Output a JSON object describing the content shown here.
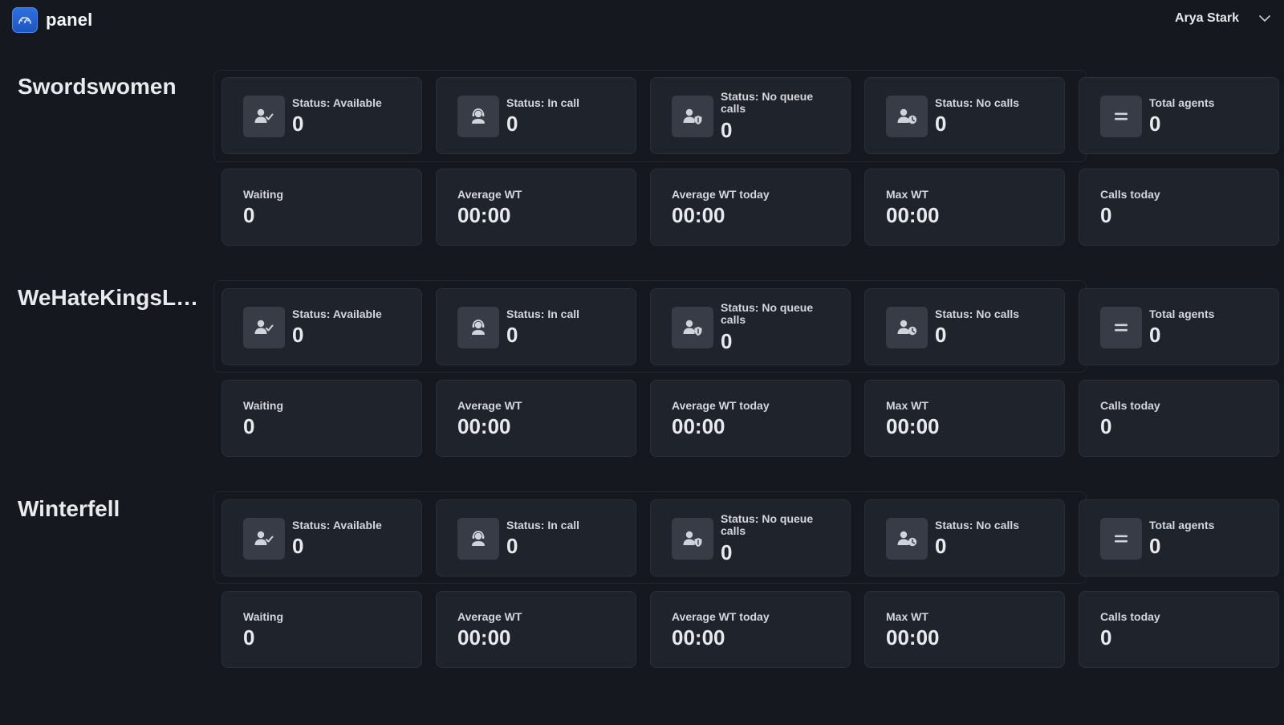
{
  "app": {
    "title": "panel"
  },
  "user": {
    "name": "Arya Stark"
  },
  "icons": {
    "logo": "dashboard-gauge-icon",
    "available": "user-check-icon",
    "in_call": "headset-agent-icon",
    "no_queue_calls": "user-shield-icon",
    "no_calls": "user-clock-icon",
    "total": "equals-icon",
    "chevron": "chevron-down-icon"
  },
  "colors": {
    "background": "#15181e",
    "card": "#1f232b",
    "icon_box": "#373c46",
    "accent": "#2f6fe0"
  },
  "queues": [
    {
      "name": "Swordswomen",
      "status": {
        "available_label": "Status: Available",
        "available_value": "0",
        "in_call_label": "Status: In call",
        "in_call_value": "0",
        "no_queue_label": "Status: No queue calls",
        "no_queue_value": "0",
        "no_calls_label": "Status: No calls",
        "no_calls_value": "0",
        "total_label": "Total agents",
        "total_value": "0"
      },
      "stats": {
        "waiting_label": "Waiting",
        "waiting_value": "0",
        "avg_wt_label": "Average WT",
        "avg_wt_value": "00:00",
        "avg_wt_today_label": "Average WT today",
        "avg_wt_today_value": "00:00",
        "max_wt_label": "Max WT",
        "max_wt_value": "00:00",
        "calls_today_label": "Calls today",
        "calls_today_value": "0"
      }
    },
    {
      "name": "WeHateKingsL…",
      "status": {
        "available_label": "Status: Available",
        "available_value": "0",
        "in_call_label": "Status: In call",
        "in_call_value": "0",
        "no_queue_label": "Status: No queue calls",
        "no_queue_value": "0",
        "no_calls_label": "Status: No calls",
        "no_calls_value": "0",
        "total_label": "Total agents",
        "total_value": "0"
      },
      "stats": {
        "waiting_label": "Waiting",
        "waiting_value": "0",
        "avg_wt_label": "Average WT",
        "avg_wt_value": "00:00",
        "avg_wt_today_label": "Average WT today",
        "avg_wt_today_value": "00:00",
        "max_wt_label": "Max WT",
        "max_wt_value": "00:00",
        "calls_today_label": "Calls today",
        "calls_today_value": "0"
      }
    },
    {
      "name": "Winterfell",
      "status": {
        "available_label": "Status: Available",
        "available_value": "0",
        "in_call_label": "Status: In call",
        "in_call_value": "0",
        "no_queue_label": "Status: No queue calls",
        "no_queue_value": "0",
        "no_calls_label": "Status: No calls",
        "no_calls_value": "0",
        "total_label": "Total agents",
        "total_value": "0"
      },
      "stats": {
        "waiting_label": "Waiting",
        "waiting_value": "0",
        "avg_wt_label": "Average WT",
        "avg_wt_value": "00:00",
        "avg_wt_today_label": "Average WT today",
        "avg_wt_today_value": "00:00",
        "max_wt_label": "Max WT",
        "max_wt_value": "00:00",
        "calls_today_label": "Calls today",
        "calls_today_value": "0"
      }
    }
  ]
}
